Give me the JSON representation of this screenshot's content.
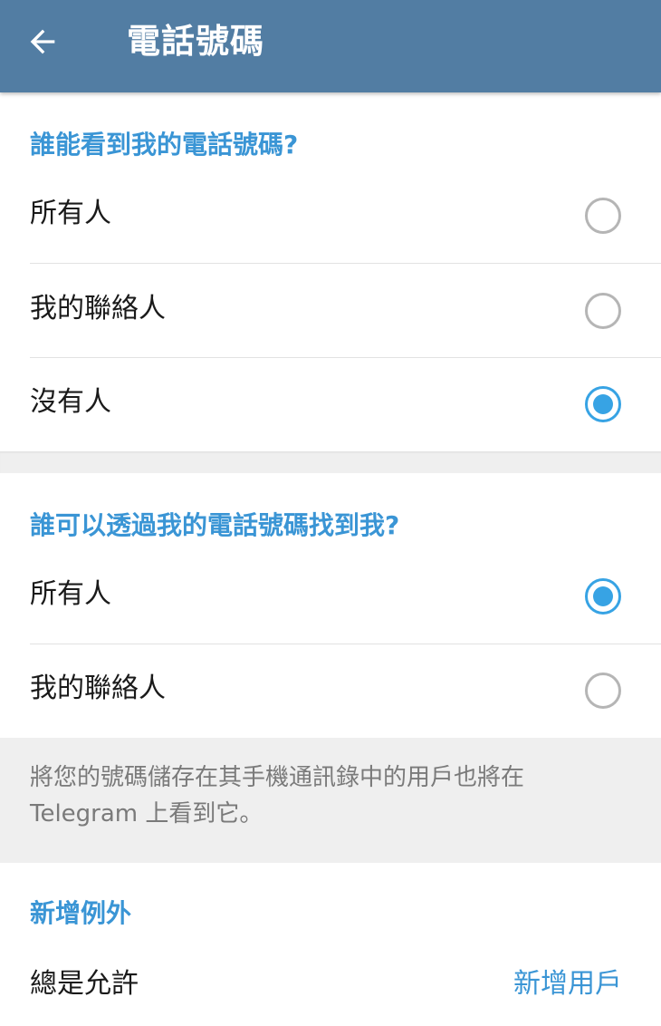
{
  "header": {
    "title": "電話號碼",
    "back_icon": "arrow-left-icon"
  },
  "colors": {
    "app_bar": "#527DA3",
    "accent": "#37A3E4",
    "section_header": "#3A95D5",
    "background_gap": "#EFEFEF"
  },
  "phone_visibility": {
    "header": "誰能看到我的電話號碼?",
    "options": [
      {
        "label": "所有人",
        "selected": false
      },
      {
        "label": "我的聯絡人",
        "selected": false
      },
      {
        "label": "沒有人",
        "selected": true
      }
    ]
  },
  "find_by_phone": {
    "header": "誰可以透過我的電話號碼找到我?",
    "options": [
      {
        "label": "所有人",
        "selected": true
      },
      {
        "label": "我的聯絡人",
        "selected": false
      }
    ],
    "info": "將您的號碼儲存在其手機通訊錄中的用戶也將在 Telegram 上看到它。"
  },
  "exceptions": {
    "header": "新增例外",
    "always_allow_label": "總是允許",
    "add_users_label": "新增用戶"
  }
}
